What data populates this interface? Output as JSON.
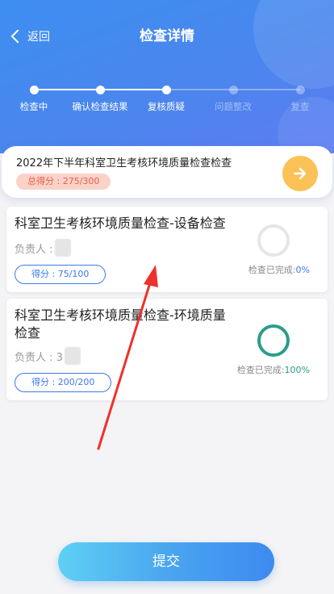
{
  "header": {
    "back_label": "返回",
    "title": "检查详情"
  },
  "steps": [
    {
      "label": "检查中",
      "active": true
    },
    {
      "label": "确认检查结果",
      "active": true
    },
    {
      "label": "复核质疑",
      "active": true
    },
    {
      "label": "问题整改",
      "active": false
    },
    {
      "label": "复查",
      "active": false
    }
  ],
  "summary": {
    "title": "2022年下半年科室卫生考核环境质量检查检查",
    "score": "总得分 : 275/300"
  },
  "items": [
    {
      "title": "科室卫生考核环境质量检查-设备检查",
      "owner_label": "负责人 :",
      "score": "得分 : 75/100",
      "progress_prefix": "检查已完成:",
      "progress_value": "0%",
      "progress_fraction": 0
    },
    {
      "title": "科室卫生考核环境质量检查-环境质量检查",
      "owner_label": "负责人 : 3",
      "score": "得分 : 200/200",
      "progress_prefix": "检查已完成:",
      "progress_value": "100%",
      "progress_fraction": 1
    }
  ],
  "submit_label": "提交",
  "colors": {
    "primary": "#3b7be8",
    "accent_yellow": "#fbc257",
    "complete_green": "#2a9d8a",
    "score_badge_text": "#e3604a",
    "annotation_red": "#f0302b"
  },
  "icons": {
    "back": "chevron-left-icon",
    "next": "arrow-right-icon"
  }
}
